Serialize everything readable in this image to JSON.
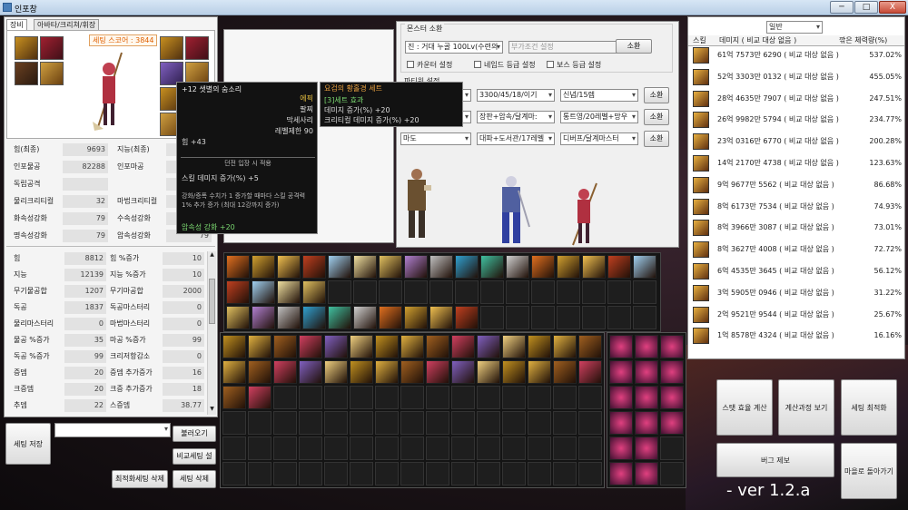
{
  "window": {
    "title": "인포창",
    "min": "─",
    "max": "□",
    "close": "X"
  },
  "tabs": [
    "장비",
    "아바타/크리쳐/휘장"
  ],
  "setting_score": "세팅 스코어 : 3844",
  "stats_top": [
    {
      "label": "힘(최종)",
      "value": "9693",
      "label2": "지능(최종)",
      "value2": ""
    },
    {
      "label": "인포물공",
      "value": "82288",
      "label2": "인포마공",
      "value2": ""
    },
    {
      "label": "독립공격",
      "value": "",
      "label2": "",
      "value2": ""
    },
    {
      "label": "물리크리티컬",
      "value": "32",
      "label2": "마법크리티컬",
      "value2": ""
    },
    {
      "label": "화속성강화",
      "value": "79",
      "label2": "수속성강화",
      "value2": "79"
    },
    {
      "label": "명속성강화",
      "value": "79",
      "label2": "암속성강화",
      "value2": "79"
    }
  ],
  "stats_bottom": [
    {
      "label": "힘",
      "value": "8812",
      "label2": "힘 %증가",
      "value2": "10"
    },
    {
      "label": "지능",
      "value": "12139",
      "label2": "지능 %증가",
      "value2": "10"
    },
    {
      "label": "무기물공합",
      "value": "1207",
      "label2": "무기마공합",
      "value2": "2000"
    },
    {
      "label": "독공",
      "value": "1837",
      "label2": "독공마스터리",
      "value2": "0"
    },
    {
      "label": "물리마스터리",
      "value": "0",
      "label2": "마법마스터리",
      "value2": "0"
    },
    {
      "label": "물공 %증가",
      "value": "35",
      "label2": "마공 %증가",
      "value2": "99"
    },
    {
      "label": "독공 %증가",
      "value": "99",
      "label2": "크리저항감소",
      "value2": "0"
    },
    {
      "label": "증뎀",
      "value": "20",
      "label2": "증뎀 추가증가",
      "value2": "16"
    },
    {
      "label": "크증뎀",
      "value": "20",
      "label2": "크증 추가증가",
      "value2": "18"
    },
    {
      "label": "추뎀",
      "value": "22",
      "label2": "스증뎀",
      "value2": "38.77"
    }
  ],
  "bottom_left": {
    "save": "세팅 저장",
    "load": "불러오기",
    "compare": "비교세팅 설정",
    "delete_opt": "최적화세팅 삭제",
    "delete": "세팅 삭제"
  },
  "tooltip1": {
    "title": "+12 샛별의 숨소리",
    "right_lines": [
      "에픽",
      "팔찌",
      "막세사리",
      "레벨제한 90"
    ],
    "str": "힘 +43",
    "dungeon": "던전 입장 시 적용",
    "skill": "스킬 데미지 증가(%) +5",
    "desc": "강화/증폭 수치가 1 증가할 때마다 스킬 공격력 1% 추가 증가 (최대 12강까지 증가)",
    "elem": "암속성 강화 +20"
  },
  "tooltip2": {
    "title": "요검의 황홀경 세트",
    "sub": "[3]세트 효과",
    "l1": "데미지 증가(%) +20",
    "l2": "크리티컬 데미지 증가(%) +20"
  },
  "monster": {
    "section": "몬스터 소환",
    "monster_dd": "진 : 거대 누골 100Lv(수련의",
    "cond_dd": "부가조건 설정",
    "summon": "소환",
    "checks": [
      "카운터 설정",
      "네임드 등급 설정",
      "보스 등급 설정"
    ],
    "party": "파티원 설정",
    "rows": [
      {
        "a": "",
        "b": "3300/45/18/이기",
        "c": "신념/15렙",
        "btn": "소환"
      },
      {
        "a": "",
        "b": "장판+암속/달계마:",
        "c": "통트영/20레벨+망우",
        "btn": "소환"
      },
      {
        "a": "마도",
        "b": "대파+도서관/17레벨",
        "c": "디버프/달계마스터",
        "btn": "소환"
      }
    ]
  },
  "right": {
    "dd": "일반",
    "h1": "스킬",
    "h2": "데미지 ( 비교 대상 없음 )",
    "h3": "깎은 체력량(%)",
    "rows": [
      {
        "d": "61억 7573만 6290 ( 비교 대상 없음 )",
        "p": "537.02%"
      },
      {
        "d": "52억 3303만 0132 ( 비교 대상 없음 )",
        "p": "455.05%"
      },
      {
        "d": "28억 4635만 7907 ( 비교 대상 없음 )",
        "p": "247.51%"
      },
      {
        "d": "26억 9982만 5794 ( 비교 대상 없음 )",
        "p": "234.77%"
      },
      {
        "d": "23억 0316만 6770 ( 비교 대상 없음 )",
        "p": "200.28%"
      },
      {
        "d": "14억 2170만 4738 ( 비교 대상 없음 )",
        "p": "123.63%"
      },
      {
        "d": "9억 9677만 5562 ( 비교 대상 없음 )",
        "p": "86.68%"
      },
      {
        "d": "8억 6173만 7534 ( 비교 대상 없음 )",
        "p": "74.93%"
      },
      {
        "d": "8억 3966만 3087 ( 비교 대상 없음 )",
        "p": "73.01%"
      },
      {
        "d": "8억 3627만 4008 ( 비교 대상 없음 )",
        "p": "72.72%"
      },
      {
        "d": "6억 4535만 3645 ( 비교 대상 없음 )",
        "p": "56.12%"
      },
      {
        "d": "3억 5905만 0946 ( 비교 대상 없음 )",
        "p": "31.22%"
      },
      {
        "d": "2억 9521만 9544 ( 비교 대상 없음 )",
        "p": "25.67%"
      },
      {
        "d": "1억 8578만 4324 ( 비교 대상 없음 )",
        "p": "16.16%"
      }
    ],
    "buttons": {
      "stat": "스탯 효율 계산",
      "process": "계산과정 보기",
      "optimize": "세팅 최적화",
      "bug": "버그 제보",
      "village": "마을로 돌아가기"
    }
  },
  "version": "- ver 1.2.a",
  "arrows": {
    "up": "▲",
    "down": "▼"
  }
}
